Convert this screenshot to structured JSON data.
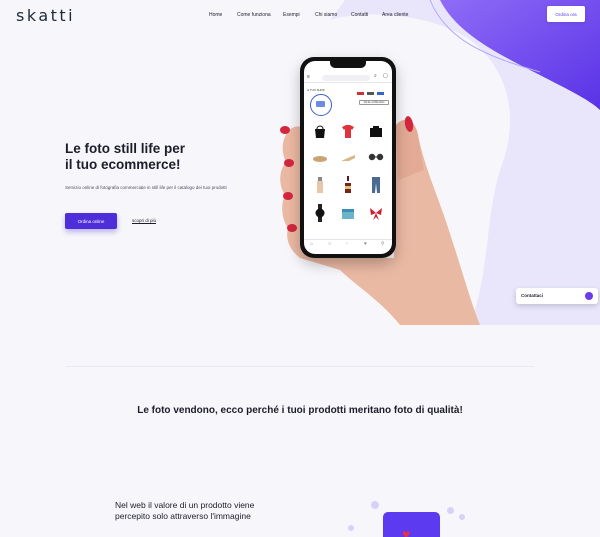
{
  "brand": {
    "logo": "skatti"
  },
  "nav": {
    "items": [
      "Home",
      "Come funziona",
      "Esempi",
      "Chi siamo",
      "Contatti",
      "Area cliente"
    ],
    "cta": "Ordina ora"
  },
  "hero": {
    "title_line1": "Le foto still life per",
    "title_line2": "il tuo ecommerce!",
    "subtitle": "Servizio online di fotografia commerciale in still life per il catalogo dei tuoi prodotti",
    "primary_cta": "Ordina online",
    "secondary_cta": "scopri di più"
  },
  "phone_app": {
    "shop_label": "IL TUO SHOP",
    "shop_button": "VAI AL CATALOGO",
    "products": [
      "handbag",
      "red-tshirt",
      "black-bag",
      "flat-shoes",
      "heels",
      "sunglasses",
      "perfume-bottle",
      "wine-bottle",
      "jeans",
      "wristwatch",
      "gift-box",
      "red-ribbon"
    ]
  },
  "contact_widget": {
    "label": "Contattaci"
  },
  "section_quality": {
    "title": "Le foto vendono, ecco perché i tuoi prodotti meritano foto di qualità!"
  },
  "section_web": {
    "text_line1": "Nel web il valore di un prodotto viene",
    "text_line2": "percepito solo attraverso l'immagine"
  },
  "colors": {
    "accent": "#4d2ed8",
    "blob": "#6a3cf0",
    "blob_light": "#e8e4fb"
  }
}
